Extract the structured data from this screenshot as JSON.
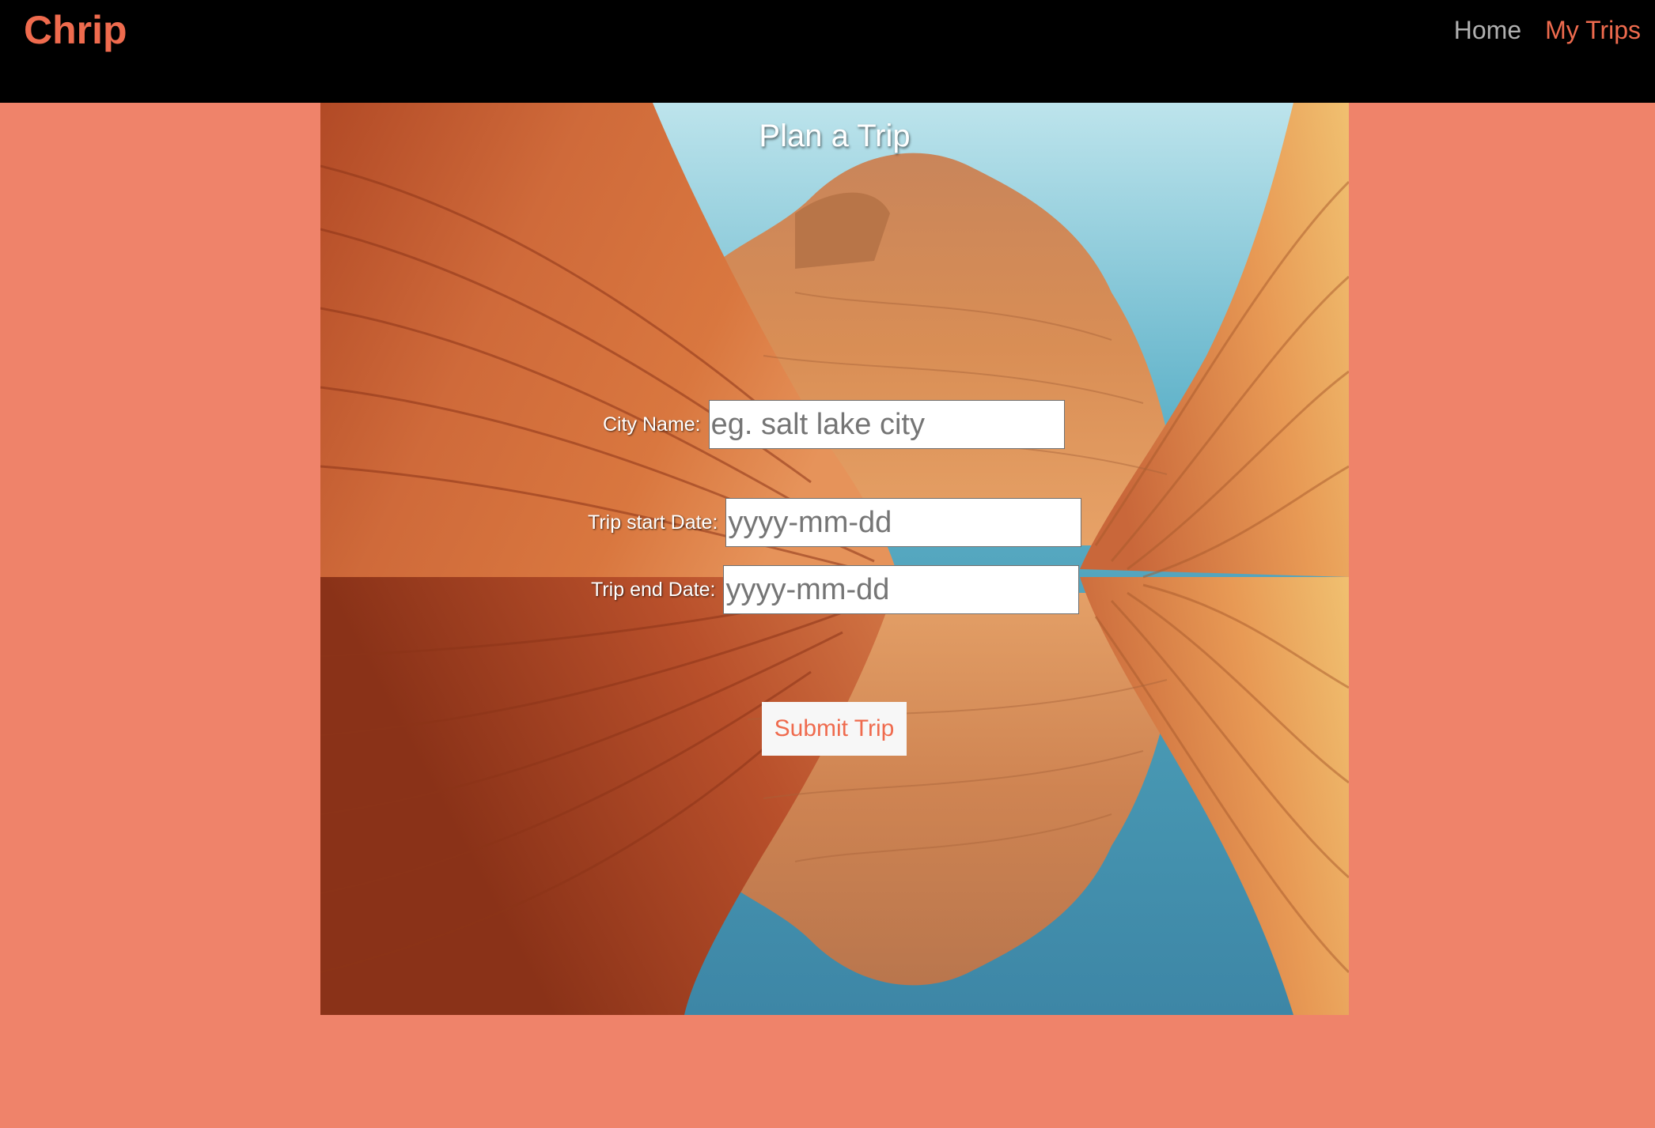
{
  "navbar": {
    "brand": "Chrip",
    "links": [
      {
        "label": "Home"
      },
      {
        "label": "My Trips"
      }
    ]
  },
  "form": {
    "title": "Plan a Trip",
    "city": {
      "label": "City Name:",
      "placeholder": "eg. salt lake city",
      "value": ""
    },
    "start_date": {
      "label": "Trip start Date:",
      "placeholder": "yyyy-mm-dd",
      "value": ""
    },
    "end_date": {
      "label": "Trip end Date:",
      "placeholder": "yyyy-mm-dd",
      "value": ""
    },
    "submit_label": "Submit Trip"
  },
  "colors": {
    "page_background": "#ef836a",
    "navbar_background": "#000000",
    "accent": "#ef6b4e",
    "nav_inactive": "#b0b0b0"
  }
}
